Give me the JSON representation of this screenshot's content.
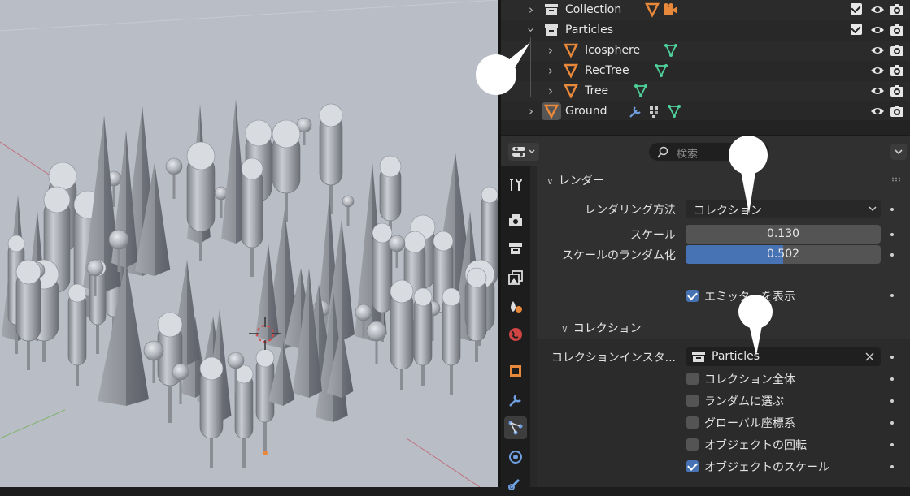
{
  "outliner": {
    "rows": [
      {
        "label": "Collection"
      },
      {
        "label": "Particles"
      },
      {
        "label": "Icosphere"
      },
      {
        "label": "RecTree"
      },
      {
        "label": "Tree"
      },
      {
        "label": "Ground"
      }
    ]
  },
  "header": {
    "search_placeholder": "検索"
  },
  "render_section": {
    "title": "レンダー",
    "render_as_label": "レンダリング方法",
    "render_as_value": "コレクション",
    "scale_label": "スケール",
    "scale_value": "0.130",
    "scale_random_label": "スケールのランダム化",
    "scale_random_value": "0.502",
    "scale_random_fraction": 0.502,
    "show_emitter_label": "エミッターを表示",
    "show_emitter_checked": true
  },
  "collection_section": {
    "title": "コレクション",
    "instance_label": "コレクションインスタ...",
    "instance_value": "Particles",
    "options": [
      {
        "label": "コレクション全体",
        "checked": false
      },
      {
        "label": "ランダムに選ぶ",
        "checked": false
      },
      {
        "label": "グローバル座標系",
        "checked": false
      },
      {
        "label": "オブジェクトの回転",
        "checked": false
      },
      {
        "label": "オブジェクトのスケール",
        "checked": true
      }
    ]
  },
  "colors": {
    "viewport_bg": "#b9bdc6",
    "accent_blue": "#4772b3",
    "mesh_orange": "#e8883a",
    "data_green": "#4ed19a"
  }
}
